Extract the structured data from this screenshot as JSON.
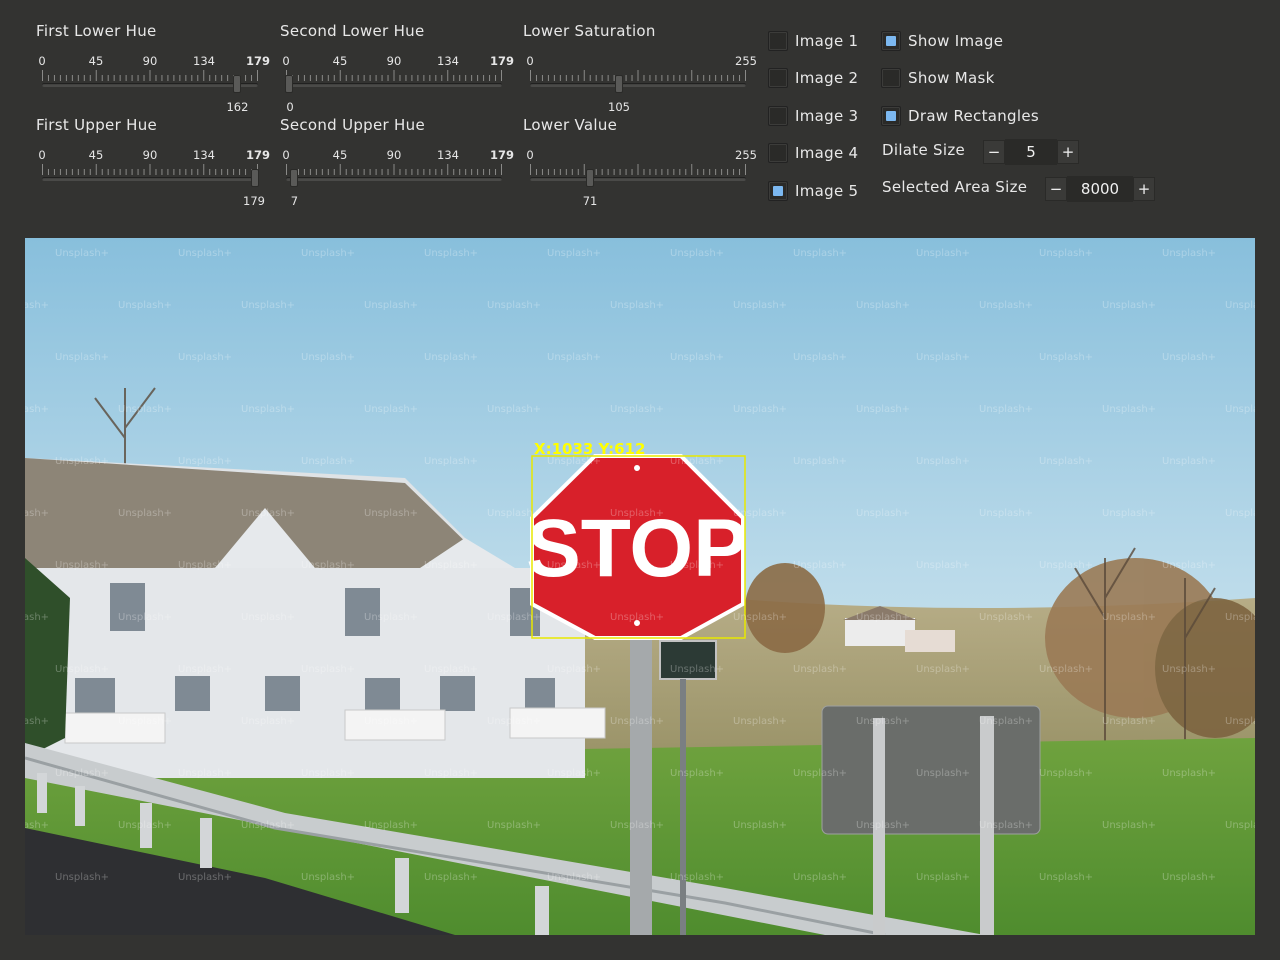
{
  "sliders": [
    {
      "label": "First Lower Hue",
      "ticks": [
        "0",
        "45",
        "90",
        "134",
        "179"
      ],
      "value": "162",
      "fraction": 0.905
    },
    {
      "label": "Second Lower Hue",
      "ticks": [
        "0",
        "45",
        "90",
        "134",
        "179"
      ],
      "value": "0",
      "fraction": 0.0
    },
    {
      "label": "Lower Saturation",
      "ticks": [
        "0",
        "255"
      ],
      "value": "105",
      "fraction": 0.412
    },
    {
      "label": "First Upper Hue",
      "ticks": [
        "0",
        "45",
        "90",
        "134",
        "179"
      ],
      "value": "179",
      "fraction": 1.0
    },
    {
      "label": "Second Upper Hue",
      "ticks": [
        "0",
        "45",
        "90",
        "134",
        "179"
      ],
      "value": "7",
      "fraction": 0.039
    },
    {
      "label": "Lower Value",
      "ticks": [
        "0",
        "255"
      ],
      "value": "71",
      "fraction": 0.278
    }
  ],
  "image_checkboxes": [
    {
      "label": "Image 1",
      "checked": false
    },
    {
      "label": "Image 2",
      "checked": false
    },
    {
      "label": "Image 3",
      "checked": false
    },
    {
      "label": "Image 4",
      "checked": false
    },
    {
      "label": "Image 5",
      "checked": true
    }
  ],
  "options": {
    "show_image": {
      "label": "Show Image",
      "checked": true
    },
    "show_mask": {
      "label": "Show Mask",
      "checked": false
    },
    "draw_rectangles": {
      "label": "Draw Rectangles",
      "checked": true
    }
  },
  "dilate": {
    "label": "Dilate Size",
    "value": "5",
    "minus": "−",
    "plus": "+"
  },
  "area": {
    "label": "Selected Area Size",
    "value": "8000",
    "minus": "−",
    "plus": "+"
  },
  "photo": {
    "sign_text": "STOP",
    "detection_label": "X:1033 Y:612",
    "watermark": "Unsplash+",
    "accent_box": "#ffff00",
    "sign_red": "#d8202a"
  }
}
